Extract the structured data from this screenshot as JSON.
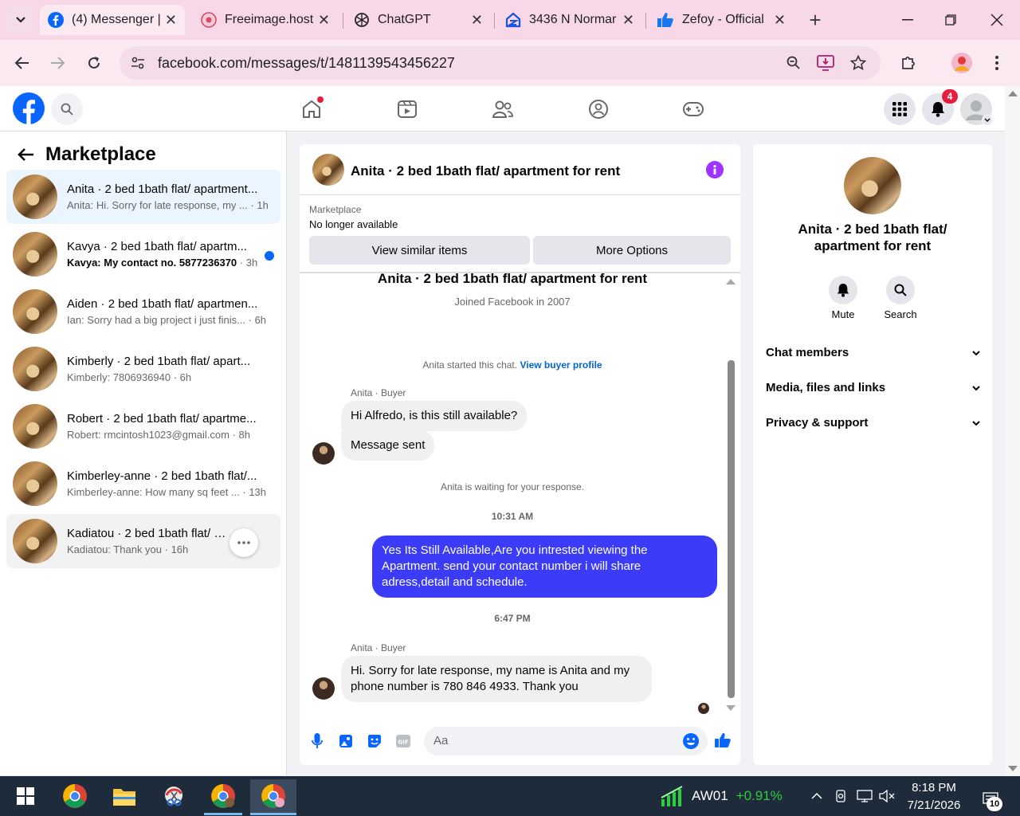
{
  "browser": {
    "tabs": [
      {
        "label": "(4) Messenger |",
        "icon": "facebook-icon"
      },
      {
        "label": "Freeimage.host",
        "icon": "freeimage-icon"
      },
      {
        "label": "ChatGPT",
        "icon": "chatgpt-icon"
      },
      {
        "label": "3436 N Normar",
        "icon": "zillow-icon"
      },
      {
        "label": "Zefoy - Official",
        "icon": "thumbs-up-icon"
      }
    ],
    "url": "facebook.com/messages/t/1481139543456227"
  },
  "fb": {
    "notification_count": "4"
  },
  "left": {
    "title": "Marketplace",
    "conversations": [
      {
        "title": "Anita · 2 bed 1bath flat/ apartment...",
        "preview": "Anita: Hi. Sorry for late response, my ...",
        "time": "· 1h"
      },
      {
        "title": "Kavya · 2 bed 1bath flat/ apartm...",
        "preview": "Kavya: My contact no. 5877236370",
        "time": "· 3h"
      },
      {
        "title": "Aiden · 2 bed 1bath flat/ apartmen...",
        "preview": "Ian: Sorry had a big project i just finis...",
        "time": "· 6h"
      },
      {
        "title": "Kimberly · 2 bed 1bath flat/ apart...",
        "preview": "Kimberly: 7806936940",
        "time": "· 6h"
      },
      {
        "title": "Robert · 2 bed 1bath flat/ apartme...",
        "preview": "Robert: rmcintosh1023@gmail.com",
        "time": "· 8h"
      },
      {
        "title": "Kimberley-anne · 2 bed 1bath flat/...",
        "preview": "Kimberley-anne: How many sq feet ...",
        "time": "· 13h"
      },
      {
        "title": "Kadiatou · 2 bed 1bath flat/ ap...",
        "preview": "Kadiatou: Thank you",
        "time": "· 16h"
      }
    ]
  },
  "chat": {
    "header_title": "Anita · 2 bed 1bath flat/ apartment for rent",
    "marketplace_label": "Marketplace",
    "status": "No longer available",
    "btn_similar": "View similar items",
    "btn_more": "More Options",
    "intro_title": "Anita · 2 bed 1bath flat/ apartment for rent",
    "intro_sub": "Joined Facebook in 2007",
    "started_text": "Anita started this chat.",
    "started_link": "View buyer profile",
    "sender1": "Anita · Buyer",
    "msg1": "Hi Alfredo, is this still available?",
    "msg2": "Message sent",
    "waiting": "Anita is waiting for your response.",
    "time1": "10:31 AM",
    "msg3": "Yes Its Still Available,Are you intrested viewing the Apartment. send your contact number i will share adress,detail and schedule.",
    "time2": "6:47 PM",
    "sender2": "Anita · Buyer",
    "msg4": "Hi. Sorry for late response, my name is Anita and my phone number is 780 846 4933. Thank you",
    "input_placeholder": "Aa"
  },
  "right": {
    "name": "Anita · 2 bed 1bath flat/ apartment for rent",
    "mute": "Mute",
    "search": "Search",
    "sections": [
      "Chat members",
      "Media, files and links",
      "Privacy & support"
    ]
  },
  "taskbar": {
    "ticker": "AW01",
    "change": "+0.91%",
    "time": "8:18 PM",
    "date": "7/21/2026",
    "notif": "10"
  },
  "colors": {
    "fb_blue": "#0866ff",
    "sent_bubble": "#3b3bf8",
    "unread_dot": "#0866ff",
    "badge_red": "#e41e3f",
    "accent_purple": "#a033ff"
  }
}
